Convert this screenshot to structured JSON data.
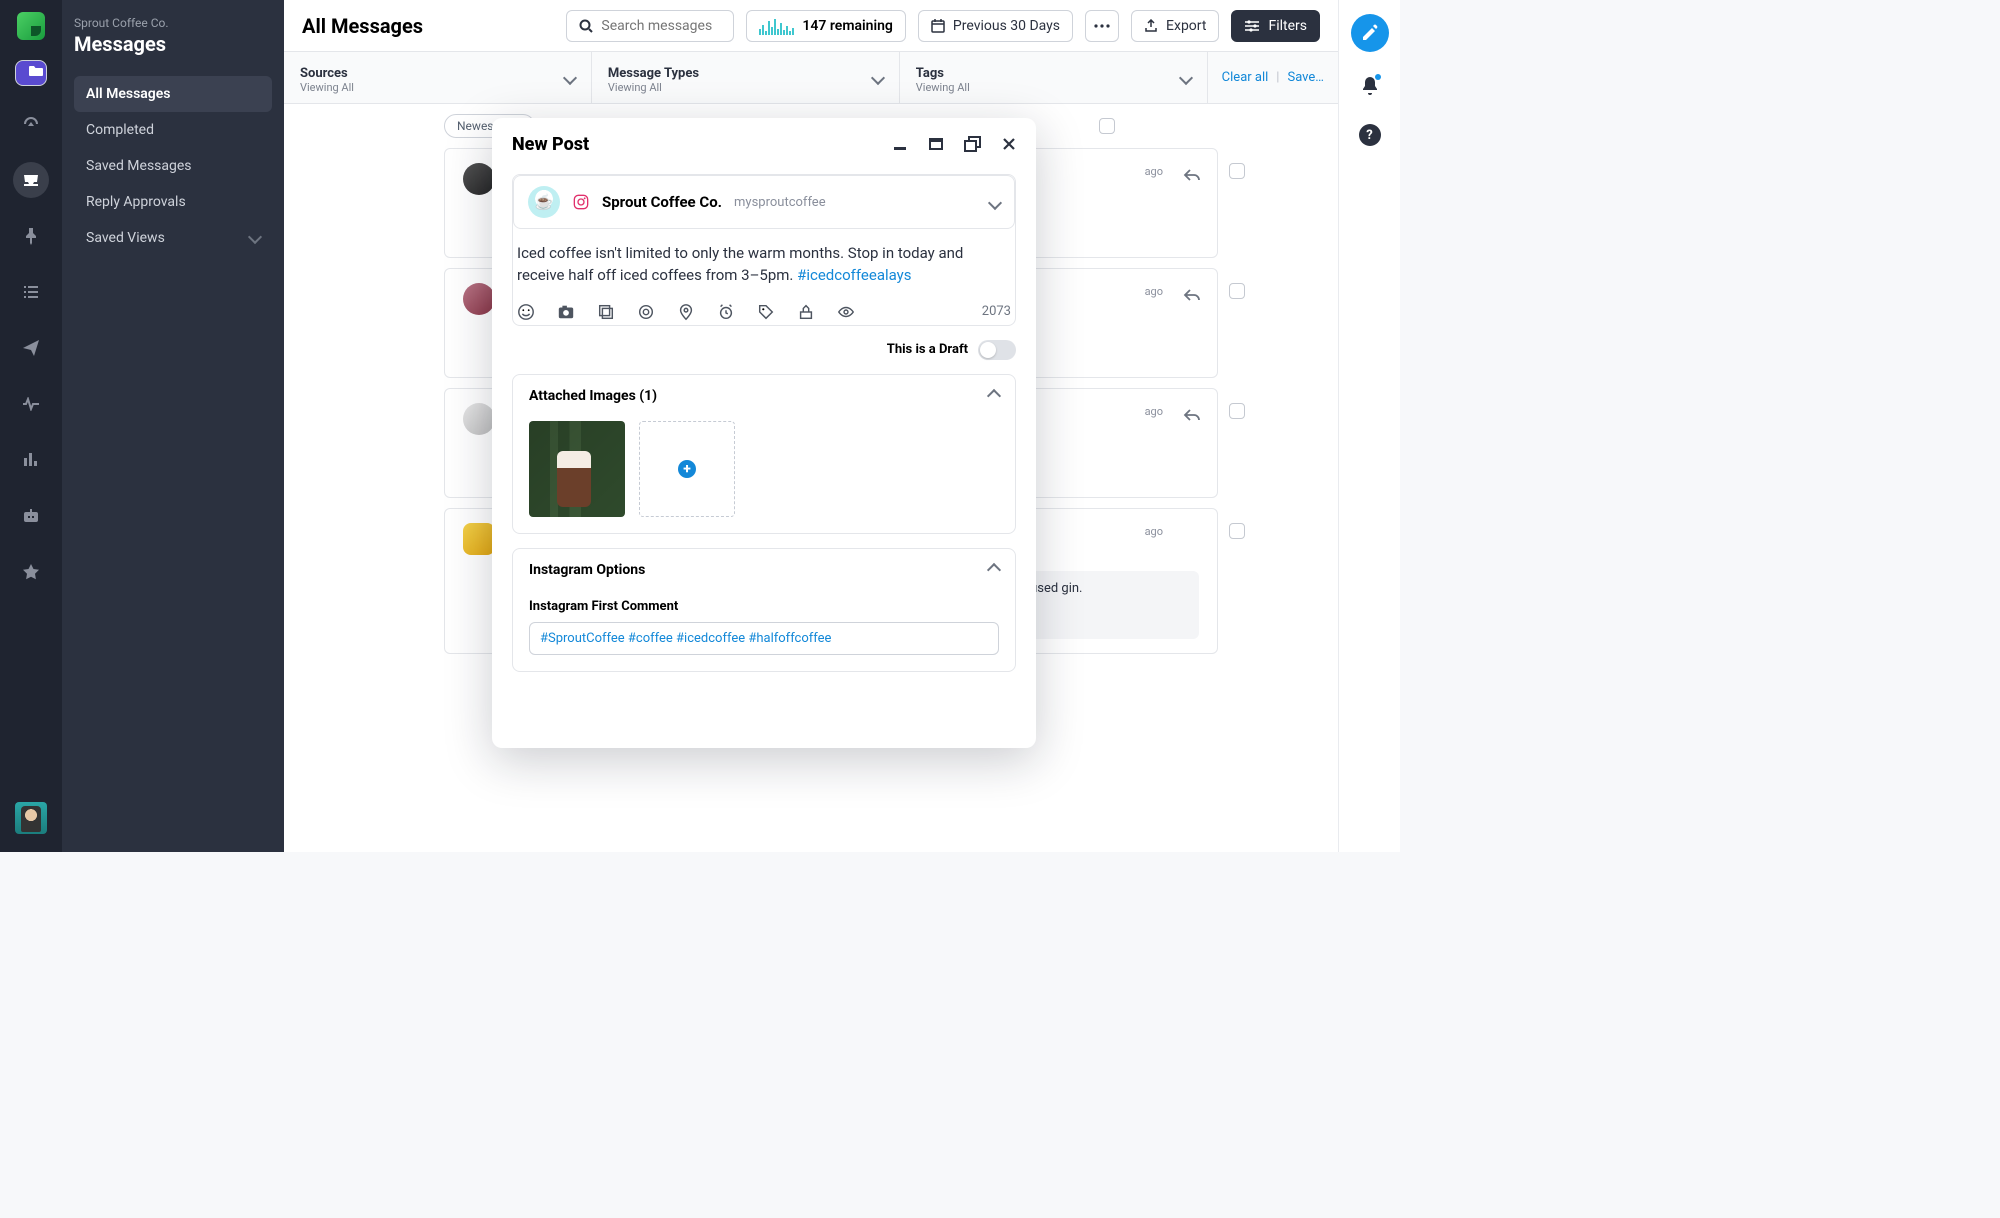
{
  "rail": {
    "icons": [
      "folder",
      "gauge",
      "inbox",
      "pin",
      "list",
      "send",
      "pulse",
      "chart",
      "bot",
      "star"
    ]
  },
  "sidebar": {
    "company": "Sprout Coffee Co.",
    "section": "Messages",
    "items": [
      {
        "label": "All Messages",
        "active": true
      },
      {
        "label": "Completed"
      },
      {
        "label": "Saved Messages"
      },
      {
        "label": "Reply Approvals"
      },
      {
        "label": "Saved Views",
        "chev": true
      }
    ]
  },
  "topbar": {
    "title": "All Messages",
    "search_placeholder": "Search messages",
    "usage_remaining": "147 remaining",
    "date_label": "Previous 30 Days",
    "export_label": "Export",
    "filters_label": "Filters"
  },
  "filters": [
    {
      "title": "Sources",
      "sub": "Viewing All"
    },
    {
      "title": "Message Types",
      "sub": "Viewing All"
    },
    {
      "title": "Tags",
      "sub": "Viewing All"
    }
  ],
  "filter_actions": {
    "clear": "Clear all",
    "save": "Save…"
  },
  "feed": {
    "sort_label": "Newest to O",
    "messages": [
      {
        "ago": "ago"
      },
      {
        "ago": "ago"
      },
      {
        "ago": "ago"
      },
      {
        "ago": "ago"
      }
    ],
    "quote_tail": "ffee infused gin."
  },
  "compose": {
    "title": "New Post",
    "profile_name": "Sprout Coffee Co.",
    "profile_handle": "mysproutcoffee",
    "post_text": "Iced coffee isn't limited to only the warm months. Stop in today and receive half off iced coffees from 3–5pm. ",
    "post_hash": "#icedcoffeealays",
    "char_count": "2073",
    "draft_label": "This is a Draft",
    "attached_label": "Attached Images (1)",
    "ig_label": "Instagram Options",
    "ig_first_comment_label": "Instagram First Comment",
    "ig_first_comment_value": "#SproutCoffee #coffee #icedcoffee #halfoffcoffee"
  }
}
